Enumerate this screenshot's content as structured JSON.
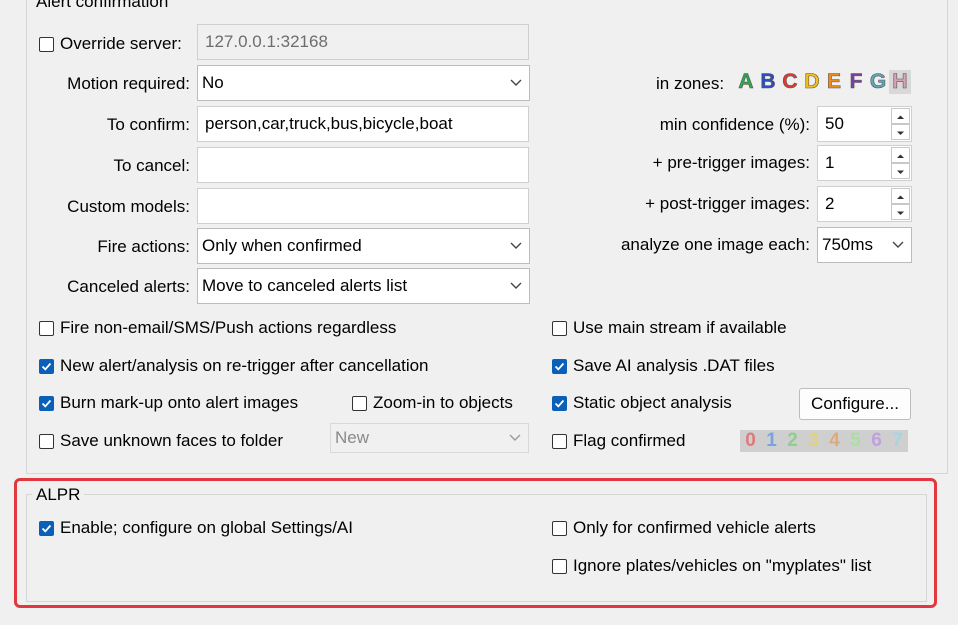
{
  "alert_group": {
    "title": "Alert confirmation",
    "override_server": {
      "label": "Override server:",
      "checked": false,
      "value": "127.0.0.1:32168"
    },
    "motion_required": {
      "label": "Motion required:",
      "value": "No"
    },
    "to_confirm": {
      "label": "To confirm:",
      "value": "person,car,truck,bus,bicycle,boat"
    },
    "to_cancel": {
      "label": "To cancel:",
      "value": ""
    },
    "custom_models": {
      "label": "Custom models:",
      "value": ""
    },
    "fire_actions": {
      "label": "Fire actions:",
      "value": "Only when confirmed"
    },
    "canceled_alerts": {
      "label": "Canceled alerts:",
      "value": "Move to canceled alerts list"
    },
    "in_zones": {
      "label": "in zones:",
      "zones": [
        {
          "letter": "A",
          "color": "#2fa84f"
        },
        {
          "letter": "B",
          "color": "#2b4fbf"
        },
        {
          "letter": "C",
          "color": "#e03a2f"
        },
        {
          "letter": "D",
          "color": "#f2c21a"
        },
        {
          "letter": "E",
          "color": "#f08c1e"
        },
        {
          "letter": "F",
          "color": "#7b3fa8"
        },
        {
          "letter": "G",
          "color": "#5fa8b8"
        },
        {
          "letter": "H",
          "color": "#d9a0b8"
        }
      ]
    },
    "min_confidence": {
      "label": "min confidence (%):",
      "value": "50"
    },
    "pre_trigger": {
      "label": "+ pre-trigger images:",
      "value": "1"
    },
    "post_trigger": {
      "label": "+ post-trigger images:",
      "value": "2"
    },
    "analyze_each": {
      "label": "analyze one image each:",
      "value": "750ms"
    },
    "checks": {
      "fire_non_email": {
        "label": "Fire non-email/SMS/Push actions regardless",
        "checked": false
      },
      "new_alert": {
        "label": "New alert/analysis on re-trigger after cancellation",
        "checked": true
      },
      "burn_markup": {
        "label": "Burn mark-up onto alert images",
        "checked": true
      },
      "zoom_in": {
        "label": "Zoom-in to objects",
        "checked": false
      },
      "save_faces": {
        "label": "Save unknown faces to folder",
        "checked": false
      },
      "use_main_stream": {
        "label": "Use main stream if available",
        "checked": false
      },
      "save_dat": {
        "label": "Save AI analysis .DAT files",
        "checked": true
      },
      "static_object": {
        "label": "Static object analysis",
        "checked": true
      },
      "flag_confirmed": {
        "label": "Flag confirmed",
        "checked": false
      }
    },
    "faces_folder": {
      "value": "New"
    },
    "configure_button": "Configure...",
    "flag_numbers": [
      "0",
      "1",
      "2",
      "3",
      "4",
      "5",
      "6",
      "7"
    ],
    "flag_colors": [
      "#e07a7a",
      "#7aa2e0",
      "#8fce8f",
      "#e0d37a",
      "#e0a97a",
      "#a9e0a0",
      "#c0a0e0",
      "#a0d8e0"
    ]
  },
  "alpr_group": {
    "title": "ALPR",
    "enable": {
      "label": "Enable; configure on global Settings/AI",
      "checked": true
    },
    "only_confirmed": {
      "label": "Only for confirmed vehicle alerts",
      "checked": false
    },
    "ignore_plates": {
      "label": "Ignore plates/vehicles on \"myplates\" list",
      "checked": false
    }
  },
  "colors": {
    "accent": "#0a5fb8",
    "highlight": "#e0383e"
  }
}
